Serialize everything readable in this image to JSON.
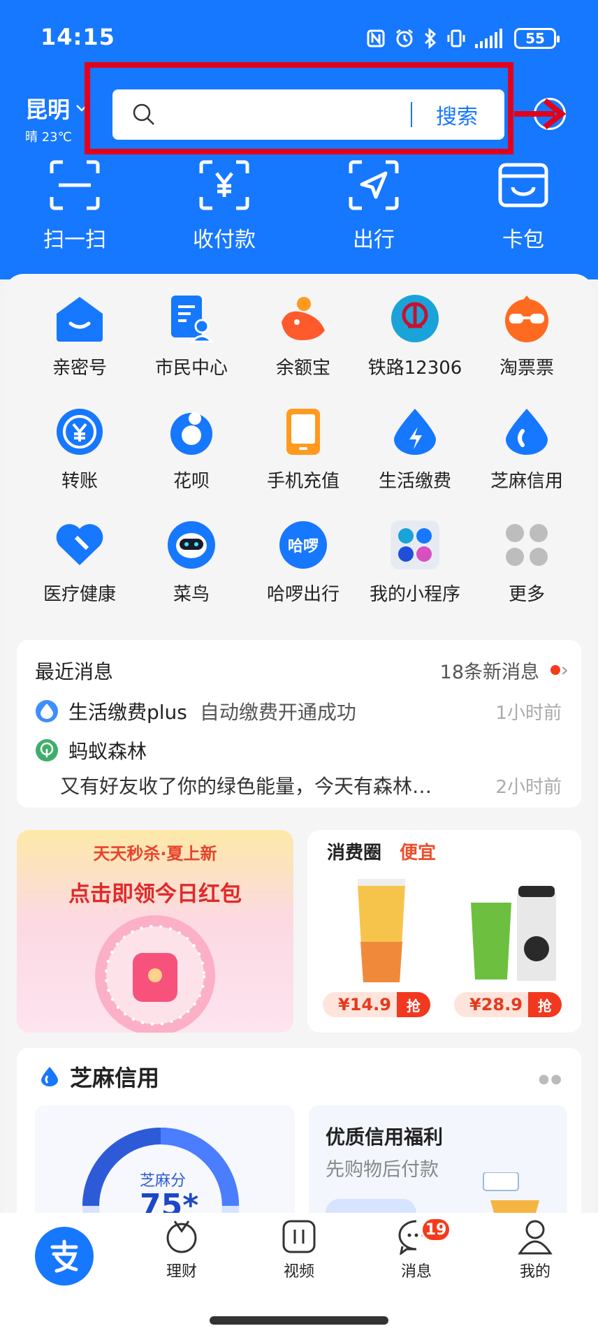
{
  "status": {
    "time": "14:15",
    "battery": "55"
  },
  "location": {
    "city": "昆明",
    "weather": "晴 23℃"
  },
  "search": {
    "placeholder": "",
    "button": "搜索"
  },
  "quick_actions": [
    "扫一扫",
    "收付款",
    "出行",
    "卡包"
  ],
  "apps": [
    [
      "亲密号",
      "市民中心",
      "余额宝",
      "铁路12306",
      "淘票票"
    ],
    [
      "转账",
      "花呗",
      "手机充值",
      "生活缴费",
      "芝麻信用"
    ],
    [
      "医疗健康",
      "菜鸟",
      "哈啰出行",
      "我的小程序",
      "更多"
    ]
  ],
  "messages": {
    "title": "最近消息",
    "count": "18条新消息",
    "items": [
      {
        "source": "生活缴费plus",
        "text": "自动缴费开通成功",
        "time": "1小时前"
      },
      {
        "source": "蚂蚁森林",
        "text": "又有好友收了你的绿色能量，今天有森林…",
        "time": "2小时前"
      }
    ]
  },
  "promo_left": {
    "subtitle": "天天秒杀·夏上新",
    "title": "点击即领今日红包"
  },
  "promo_right": {
    "title": "消费圈",
    "tag": "便宜",
    "items": [
      {
        "price": "¥14.9",
        "btn": "抢"
      },
      {
        "price": "¥28.9",
        "btn": "抢"
      }
    ]
  },
  "credit": {
    "title": "芝麻信用",
    "score_label": "芝麻分",
    "score_partial": "75*",
    "right_title": "优质信用福利",
    "right_sub": "先购物后付款"
  },
  "tabbar": {
    "tabs": [
      "理财",
      "视频",
      "消息",
      "我的"
    ],
    "badge": "19"
  },
  "colors": {
    "brand_blue": "#1677ff",
    "highlight_red": "#e3001b",
    "price_red": "#e53a1c"
  }
}
